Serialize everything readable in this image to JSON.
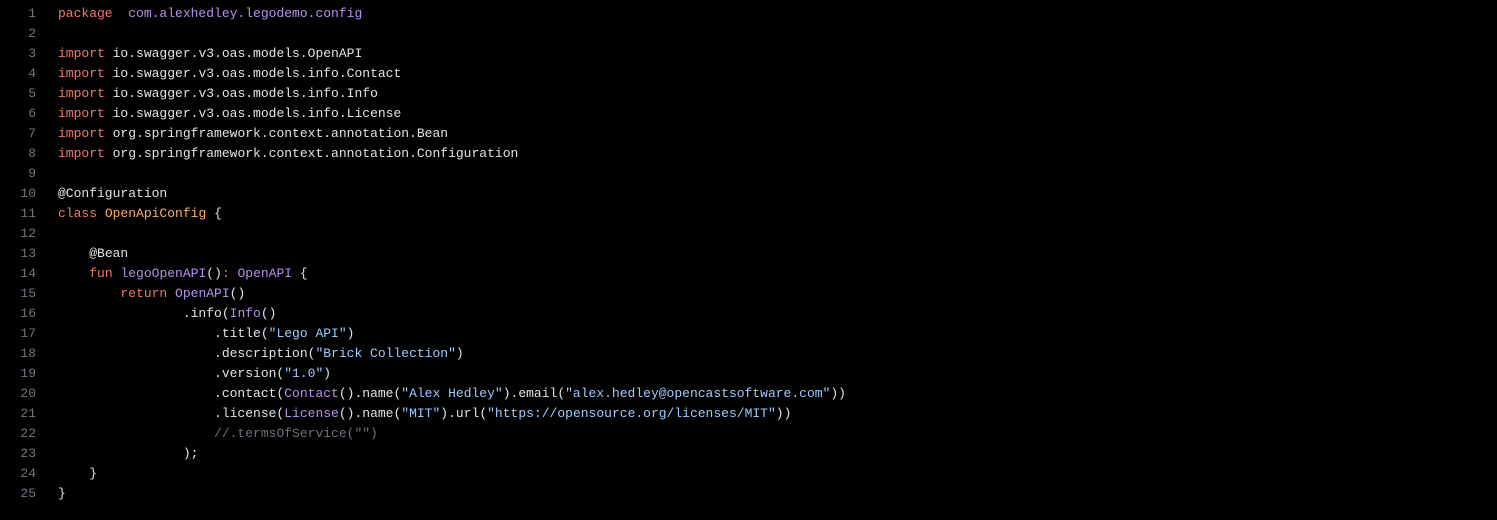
{
  "lines": [
    {
      "num": "1",
      "tokens": [
        {
          "c": "kw-red",
          "t": "package"
        },
        {
          "c": "white",
          "t": "  "
        },
        {
          "c": "pkg",
          "t": "com.alexhedley.legodemo.config"
        }
      ]
    },
    {
      "num": "2",
      "tokens": []
    },
    {
      "num": "3",
      "tokens": [
        {
          "c": "kw-red",
          "t": "import"
        },
        {
          "c": "white",
          "t": " "
        },
        {
          "c": "white",
          "t": "io.swagger.v3.oas.models.OpenAPI"
        }
      ]
    },
    {
      "num": "4",
      "tokens": [
        {
          "c": "kw-red",
          "t": "import"
        },
        {
          "c": "white",
          "t": " "
        },
        {
          "c": "white",
          "t": "io.swagger.v3.oas.models.info.Contact"
        }
      ]
    },
    {
      "num": "5",
      "tokens": [
        {
          "c": "kw-red",
          "t": "import"
        },
        {
          "c": "white",
          "t": " "
        },
        {
          "c": "white",
          "t": "io.swagger.v3.oas.models.info.Info"
        }
      ]
    },
    {
      "num": "6",
      "tokens": [
        {
          "c": "kw-red",
          "t": "import"
        },
        {
          "c": "white",
          "t": " "
        },
        {
          "c": "white",
          "t": "io.swagger.v3.oas.models.info.License"
        }
      ]
    },
    {
      "num": "7",
      "tokens": [
        {
          "c": "kw-red",
          "t": "import"
        },
        {
          "c": "white",
          "t": " "
        },
        {
          "c": "white",
          "t": "org.springframework.context.annotation.Bean"
        }
      ]
    },
    {
      "num": "8",
      "tokens": [
        {
          "c": "kw-red",
          "t": "import"
        },
        {
          "c": "white",
          "t": " "
        },
        {
          "c": "white",
          "t": "org.springframework.context.annotation.Configuration"
        }
      ]
    },
    {
      "num": "9",
      "tokens": []
    },
    {
      "num": "10",
      "tokens": [
        {
          "c": "annotation",
          "t": "@Configuration"
        }
      ]
    },
    {
      "num": "11",
      "tokens": [
        {
          "c": "kw-red",
          "t": "class"
        },
        {
          "c": "white",
          "t": " "
        },
        {
          "c": "fn-yellow",
          "t": "OpenApiConfig"
        },
        {
          "c": "white",
          "t": " "
        },
        {
          "c": "punct",
          "t": "{"
        }
      ]
    },
    {
      "num": "12",
      "tokens": []
    },
    {
      "num": "13",
      "tokens": [
        {
          "c": "white",
          "t": "    "
        },
        {
          "c": "annotation",
          "t": "@Bean"
        }
      ]
    },
    {
      "num": "14",
      "tokens": [
        {
          "c": "white",
          "t": "    "
        },
        {
          "c": "kw-red",
          "t": "fun"
        },
        {
          "c": "white",
          "t": " "
        },
        {
          "c": "method",
          "t": "legoOpenAPI"
        },
        {
          "c": "punct",
          "t": "()"
        },
        {
          "c": "kw-red",
          "t": ":"
        },
        {
          "c": "white",
          "t": " "
        },
        {
          "c": "type",
          "t": "OpenAPI"
        },
        {
          "c": "white",
          "t": " "
        },
        {
          "c": "punct",
          "t": "{"
        }
      ]
    },
    {
      "num": "15",
      "tokens": [
        {
          "c": "white",
          "t": "        "
        },
        {
          "c": "kw-red",
          "t": "return"
        },
        {
          "c": "white",
          "t": " "
        },
        {
          "c": "type",
          "t": "OpenAPI"
        },
        {
          "c": "punct",
          "t": "()"
        }
      ]
    },
    {
      "num": "16",
      "tokens": [
        {
          "c": "white",
          "t": "                .info("
        },
        {
          "c": "type",
          "t": "Info"
        },
        {
          "c": "punct",
          "t": "()"
        }
      ]
    },
    {
      "num": "17",
      "tokens": [
        {
          "c": "white",
          "t": "                    .title("
        },
        {
          "c": "str",
          "t": "\"Lego API\""
        },
        {
          "c": "punct",
          "t": ")"
        }
      ]
    },
    {
      "num": "18",
      "tokens": [
        {
          "c": "white",
          "t": "                    .description("
        },
        {
          "c": "str",
          "t": "\"Brick Collection\""
        },
        {
          "c": "punct",
          "t": ")"
        }
      ]
    },
    {
      "num": "19",
      "tokens": [
        {
          "c": "white",
          "t": "                    .version("
        },
        {
          "c": "str",
          "t": "\"1.0\""
        },
        {
          "c": "punct",
          "t": ")"
        }
      ]
    },
    {
      "num": "20",
      "tokens": [
        {
          "c": "white",
          "t": "                    .contact("
        },
        {
          "c": "type",
          "t": "Contact"
        },
        {
          "c": "punct",
          "t": "()"
        },
        {
          "c": "white",
          "t": ".name("
        },
        {
          "c": "str",
          "t": "\"Alex Hedley\""
        },
        {
          "c": "punct",
          "t": ")"
        },
        {
          "c": "white",
          "t": ".email("
        },
        {
          "c": "str",
          "t": "\"alex.hedley@opencastsoftware.com\""
        },
        {
          "c": "punct",
          "t": "))"
        }
      ]
    },
    {
      "num": "21",
      "tokens": [
        {
          "c": "white",
          "t": "                    .license("
        },
        {
          "c": "type",
          "t": "License"
        },
        {
          "c": "punct",
          "t": "()"
        },
        {
          "c": "white",
          "t": ".name("
        },
        {
          "c": "str",
          "t": "\"MIT\""
        },
        {
          "c": "punct",
          "t": ")"
        },
        {
          "c": "white",
          "t": ".url("
        },
        {
          "c": "str",
          "t": "\"https://opensource.org/licenses/MIT\""
        },
        {
          "c": "punct",
          "t": "))"
        }
      ]
    },
    {
      "num": "22",
      "tokens": [
        {
          "c": "white",
          "t": "                    "
        },
        {
          "c": "comment",
          "t": "//.termsOfService(\"\")"
        }
      ]
    },
    {
      "num": "23",
      "tokens": [
        {
          "c": "white",
          "t": "                "
        },
        {
          "c": "punct",
          "t": ");"
        }
      ]
    },
    {
      "num": "24",
      "tokens": [
        {
          "c": "white",
          "t": "    "
        },
        {
          "c": "punct",
          "t": "}"
        }
      ]
    },
    {
      "num": "25",
      "tokens": [
        {
          "c": "punct",
          "t": "}"
        }
      ]
    }
  ]
}
